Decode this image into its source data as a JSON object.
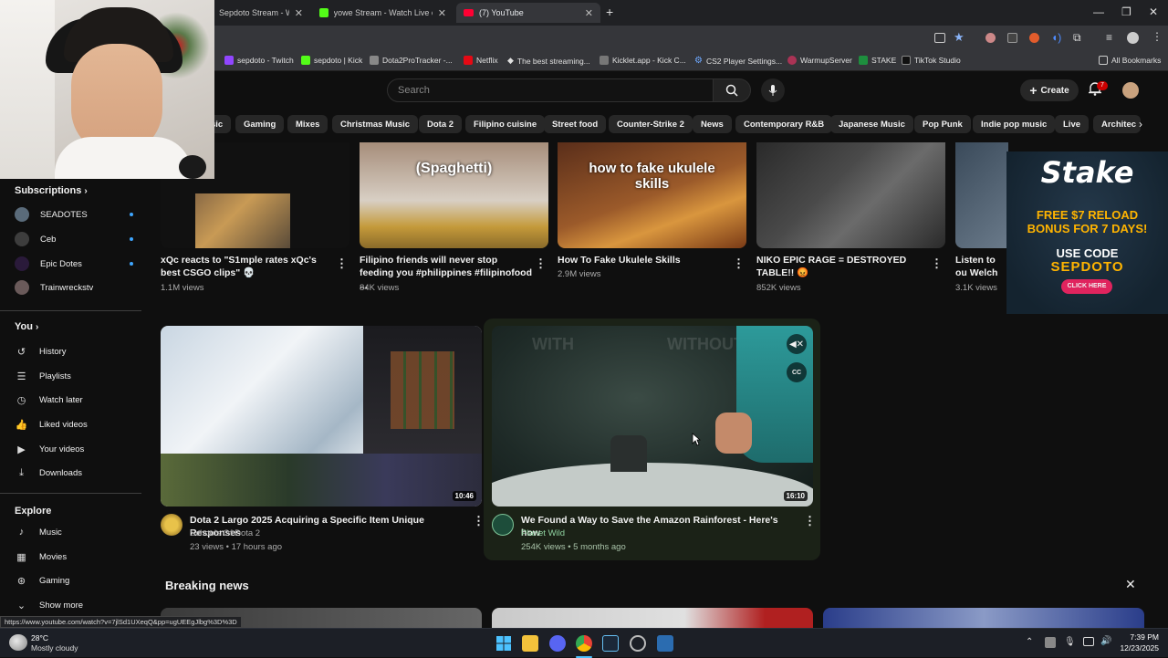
{
  "browser": {
    "tabs": [
      {
        "title": "Sepdoto Stream - Watch Live"
      },
      {
        "title": "yowe Stream - Watch Live on K"
      },
      {
        "title": "(7) YouTube"
      }
    ],
    "bookmarks": [
      "sepdoto - Twitch",
      "sepdoto | Kick",
      "Dota2ProTracker -...",
      "Netflix",
      "The best streaming...",
      "Kicklet.app - Kick C...",
      "CS2 Player Settings...",
      "WarmupServer",
      "STAKE",
      "TikTok Studio"
    ],
    "all_bookmarks": "All Bookmarks",
    "status_url": "https://www.youtube.com/watch?v=7jlSd1UXeqQ&pp=ugUEEgJlbg%3D%3D"
  },
  "header": {
    "search_placeholder": "Search",
    "create_label": "Create",
    "notifications_count": "7"
  },
  "chips": [
    "sic",
    "Gaming",
    "Mixes",
    "Christmas Music",
    "Dota 2",
    "Filipino cuisine",
    "Street food",
    "Counter-Strike 2",
    "News",
    "Contemporary R&B",
    "Japanese Music",
    "Pop Punk",
    "Indie pop music",
    "Live",
    "Architec"
  ],
  "sidebar": {
    "subscriptions_label": "Subscriptions",
    "subscriptions": [
      "SEADOTES",
      "Ceb",
      "Epic Dotes",
      "Trainwreckstv"
    ],
    "you_label": "You",
    "you_items": [
      "History",
      "Playlists",
      "Watch later",
      "Liked videos",
      "Your videos",
      "Downloads"
    ],
    "explore_label": "Explore",
    "explore_items": [
      "Music",
      "Movies",
      "Gaming",
      "Show more"
    ]
  },
  "top_row": [
    {
      "title": "xQc reacts to \"S1mple rates xQc's best CSGO clips\" 💀",
      "meta": "1.1M views",
      "overlay": ""
    },
    {
      "title": "Filipino friends will never stop feeding you  #philippines #filipinofood ...",
      "meta": "84K views",
      "overlay": "(Spaghetti)"
    },
    {
      "title": "How To Fake Ukulele Skills",
      "meta": "2.9M views",
      "overlay": "how to fake ukulele skills"
    },
    {
      "title": "NIKO EPIC RAGE = DESTROYED TABLE!! 😡",
      "meta": "852K views",
      "overlay": ""
    },
    {
      "title": "Listen to ou Welch now",
      "meta": "3.1K views",
      "overlay": ""
    }
  ],
  "mid_row": [
    {
      "title": "Dota 2 Largo 2025 Acquiring a Specific Item Unique Responses",
      "channel": "Schools Of Dota 2",
      "meta": "23 views • 17 hours ago",
      "duration": "10:46"
    },
    {
      "title": "We Found a Way to Save the Amazon Rainforest - Here's how",
      "channel": "Planet Wild",
      "meta": "254K views • 5 months ago",
      "duration": "16:10",
      "overlay_left": "WITH",
      "overlay_right": "WITHOUT"
    }
  ],
  "breaking_news": "Breaking news",
  "ad": {
    "brand": "Stake",
    "line1": "FREE $7 RELOAD",
    "line2": "BONUS FOR 7 DAYS!",
    "line3": "USE CODE",
    "code": "SEPDOTO",
    "cta": "CLICK HERE"
  },
  "taskbar": {
    "weather_temp": "28°C",
    "weather_desc": "Mostly cloudy",
    "time": "7:39 PM",
    "date": "12/23/2025"
  },
  "colors": {
    "youtube_red": "#ff0033",
    "stake_bg": "#1a2c38",
    "accent_blue": "#3ea6ff"
  }
}
